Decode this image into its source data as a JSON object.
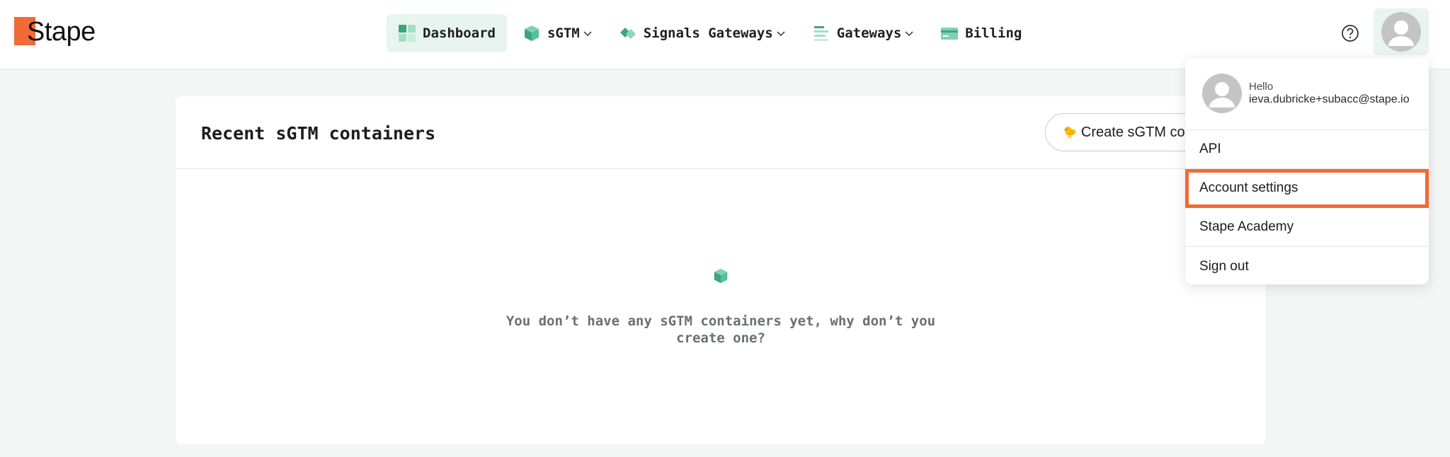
{
  "brand": {
    "name": "Stape",
    "accent": "#f26a35",
    "green": "#3aa57f"
  },
  "nav": {
    "items": [
      {
        "label": "Dashboard",
        "icon": "dashboard-grid-icon",
        "active": true
      },
      {
        "label": "sGTM",
        "icon": "cube-icon",
        "dropdown": true
      },
      {
        "label": "Signals Gateways",
        "icon": "signals-icon",
        "dropdown": true
      },
      {
        "label": "Gateways",
        "icon": "gateways-list-icon",
        "dropdown": true
      },
      {
        "label": "Billing",
        "icon": "credit-card-icon"
      }
    ]
  },
  "header_actions": {
    "help_icon": "question-circle-icon",
    "avatar_icon": "user-avatar-icon"
  },
  "card": {
    "title": "Recent sGTM containers",
    "create_button": "Create sGTM con",
    "create_emoji": "🐤",
    "empty_icon": "cube-icon",
    "empty_message": "You don’t have any sGTM containers yet, why don’t you create one?"
  },
  "dropdown": {
    "hello": "Hello",
    "email": "ieva.dubricke+subacc@stape.io",
    "items": [
      {
        "label": "API"
      },
      {
        "label": "Account settings",
        "highlighted": true
      },
      {
        "label": "Stape Academy"
      },
      {
        "label": "Sign out"
      }
    ]
  }
}
